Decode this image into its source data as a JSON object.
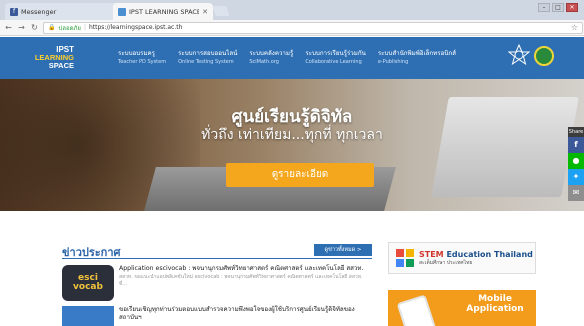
{
  "browser": {
    "tabs": [
      {
        "label": "Messenger",
        "active": false
      },
      {
        "label": "IPST LEARNING SPACE",
        "active": true
      }
    ],
    "address": {
      "secure_label": "ปลอดภัย",
      "url": "https://learningspace.ipst.ac.th"
    }
  },
  "header": {
    "logo": {
      "line1": "IPST",
      "line2": "LEARNING",
      "line3": "SPACE"
    },
    "nav": [
      {
        "th": "ระบบอบรมครู",
        "en": "Teacher PD System"
      },
      {
        "th": "ระบบการสอบออนไลน์",
        "en": "Online Testing System"
      },
      {
        "th": "ระบบคลังความรู้",
        "en": "SciMath.org"
      },
      {
        "th": "ระบบการเรียนรู้ร่วมกัน",
        "en": "Collaborative Learning"
      },
      {
        "th": "ระบบสำนักพิมพ์อิเล็กทรอนิกส์",
        "en": "e-Publishing"
      }
    ]
  },
  "hero": {
    "title": "ศูนย์เรียนรู้ดิจิทัล",
    "subtitle": "ทั่วถึง เท่าเทียม...ทุกที่ ทุกเวลา",
    "button": "ดูรายละเอียด"
  },
  "share": {
    "label": "Share",
    "buttons": [
      "f",
      "●",
      "✦",
      "✉"
    ]
  },
  "news": {
    "heading": "ข่าวประกาศ",
    "all_button": "ดูข่าวทั้งหมด >",
    "items": [
      {
        "title": "Application escivocab : พจนานุกรมศัพท์วิทยาศาสตร์ คณิตศาสตร์ และเทคโนโลยี สสวท.",
        "excerpt": "สสวท. ขอแนะนำแอปพลิเคชันใหม่ escivocab : พจนานุกรมศัพท์วิทยาศาสตร์ คณิตศาสตร์ และเทคโนโลยี สสวท. ที่...",
        "thumb_text": "esci vocab"
      },
      {
        "title": "ขอเรียนเชิญทุกท่านร่วมตอบแบบสำรวจความพึงพอใจของผู้ใช้บริการศูนย์เรียนรู้ดิจิทัลของสถาบันฯ",
        "excerpt": "",
        "thumb_text": ""
      }
    ]
  },
  "ads": {
    "stem": {
      "title_accent": "STEM",
      "title_rest": " Education Thailand",
      "subtitle": "สะเต็มศึกษา ประเทศไทย"
    },
    "mobile": {
      "line1": "Mobile",
      "line2": "Application"
    }
  }
}
